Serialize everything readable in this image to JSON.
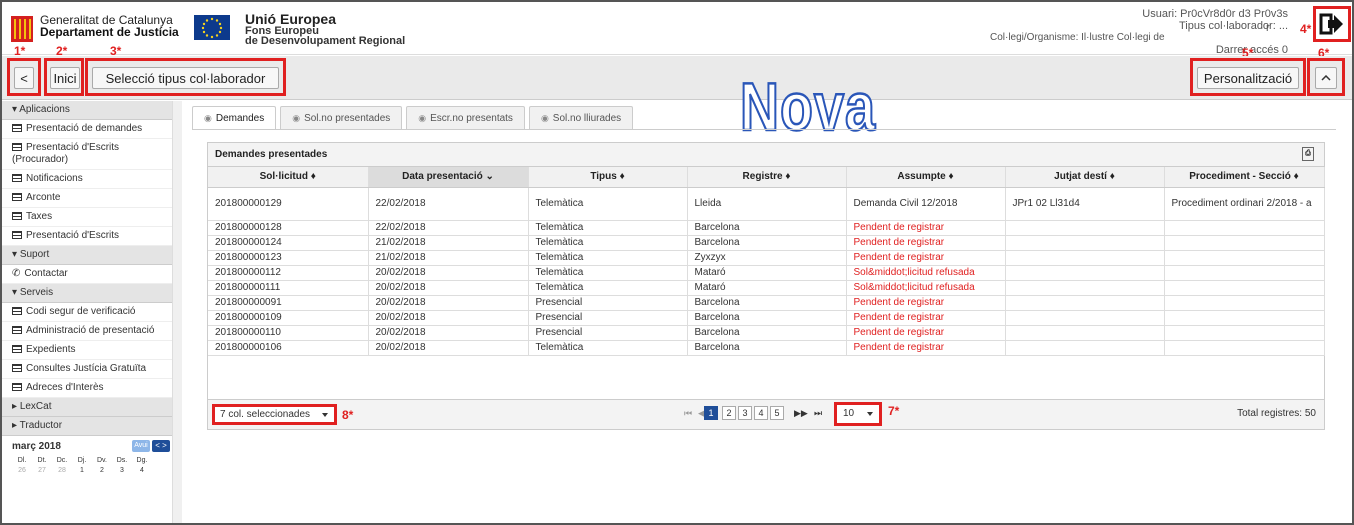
{
  "header": {
    "gencat_line1": "Generalitat de Catalunya",
    "gencat_line2": "Departament de Justícia",
    "eu_line1": "Unió Europea",
    "eu_line2": "Fons Europeu",
    "eu_line3": "de Desenvolupament Regional",
    "user_line": "Usuari: Pr0cVr8d0r d3 Pr0v3s",
    "type_line": "Tipus col·laborador: ...",
    "org_line": "Col·legi/Organisme: Il·lustre Col·legi de",
    "last_access": "Darrer accés 0"
  },
  "toolbar": {
    "back_label": "<",
    "home_label": "Inici",
    "selector_label": "Selecció tipus col·laborador",
    "customize_label": "Personalització",
    "collapse_label": "^",
    "banner": "Nova"
  },
  "annotations": {
    "a1": "1*",
    "a2": "2*",
    "a3": "3*",
    "a4": "4*",
    "a4b": "r",
    "a5": "5*",
    "a6": "6*",
    "a7": "7*",
    "a8": "8*"
  },
  "sidebar": {
    "sections": [
      {
        "title": "Aplicacions",
        "items": [
          "Presentació de demandes",
          "Presentació d'Escrits (Procurador)",
          "Notificacions",
          "Arconte",
          "Taxes",
          "Presentació d'Escrits"
        ]
      },
      {
        "title": "Suport",
        "items": [
          "Contactar"
        ]
      },
      {
        "title": "Serveis",
        "items": [
          "Codi segur de verificació",
          "Administració de presentació",
          "Expedients",
          "Consultes Justícia Gratuïta",
          "Adreces d'Interès"
        ]
      }
    ],
    "collapsed": [
      "LexCat",
      "Traductor"
    ],
    "calendar": {
      "month": "març 2018",
      "today_label": "Avui",
      "days": [
        "Dl.",
        "Dt.",
        "Dc.",
        "Dj.",
        "Dv.",
        "Ds.",
        "Dg."
      ],
      "first_row": [
        "26",
        "27",
        "28",
        "1",
        "2",
        "3",
        "4"
      ]
    }
  },
  "tabs": [
    "Demandes",
    "Sol.no presentades",
    "Escr.no presentats",
    "Sol.no lliurades"
  ],
  "grid": {
    "title": "Demandes presentades",
    "columns": [
      "Sol·licitud ♦",
      "Data presentació ⌄",
      "Tipus ♦",
      "Registre ♦",
      "Assumpte ♦",
      "Jutjat destí ♦",
      "Procediment - Secció ♦"
    ],
    "rows": [
      [
        "201800000129",
        "22/02/2018",
        "Telemàtica",
        "Lleida",
        "Demanda Civil 12/2018",
        "JPr1 02 Ll31d4",
        "Procediment ordinari 2/2018 - a"
      ],
      [
        "201800000128",
        "22/02/2018",
        "Telemàtica",
        "Barcelona",
        "Pendent de registrar",
        "",
        ""
      ],
      [
        "201800000124",
        "21/02/2018",
        "Telemàtica",
        "Barcelona",
        "Pendent de registrar",
        "",
        ""
      ],
      [
        "201800000123",
        "21/02/2018",
        "Telemàtica",
        "Zyxzyx",
        "Pendent de registrar",
        "",
        ""
      ],
      [
        "201800000112",
        "20/02/2018",
        "Telemàtica",
        "Mataró",
        "Sol&middot;licitud refusada",
        "",
        ""
      ],
      [
        "201800000111",
        "20/02/2018",
        "Telemàtica",
        "Mataró",
        "Sol&middot;licitud refusada",
        "",
        ""
      ],
      [
        "201800000091",
        "20/02/2018",
        "Presencial",
        "Barcelona",
        "Pendent de registrar",
        "",
        ""
      ],
      [
        "201800000109",
        "20/02/2018",
        "Presencial",
        "Barcelona",
        "Pendent de registrar",
        "",
        ""
      ],
      [
        "201800000110",
        "20/02/2018",
        "Presencial",
        "Barcelona",
        "Pendent de registrar",
        "",
        ""
      ],
      [
        "201800000106",
        "20/02/2018",
        "Telemàtica",
        "Barcelona",
        "Pendent de registrar",
        "",
        ""
      ]
    ],
    "col_selector": "7 col. seleccionades",
    "pages": [
      "1",
      "2",
      "3",
      "4",
      "5"
    ],
    "per_page": "10",
    "total": "Total registres: 50"
  },
  "colors": {
    "accent": "#1f4e99",
    "alert": "#e02020",
    "banner_stroke": "#2a56b8"
  }
}
